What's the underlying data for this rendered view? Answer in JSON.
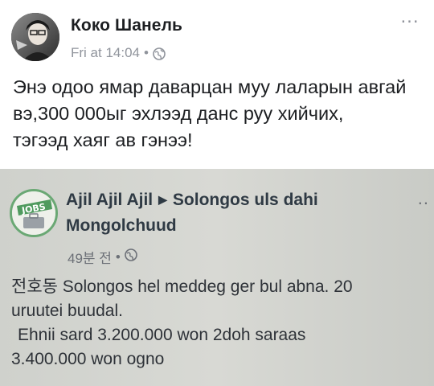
{
  "post": {
    "author": "Коко Шанель",
    "timestamp": "Fri at 14:04",
    "meta_separator": "•",
    "text_lines": [
      "Энэ одоо ямар даварцан муу лаларын авгай",
      "вэ,300 000ыг эхлээд данс руу хийчих,",
      "тэгээд хаяг  ав гэнээ!"
    ],
    "more_label": "...",
    "privacy_icon": "globe-icon"
  },
  "shared_post": {
    "page_name": "Ajil Ajil Ajil",
    "separator_icon": "triangle-right-icon",
    "group_name_part1": "Solongos uls dahi",
    "group_name_part2": "Mongolchuud",
    "time_ago": "49분 전",
    "meta_separator": "•",
    "more_label": "..",
    "avatar_text": "JOBS",
    "body_lines": [
      "전호동 Solongos hel meddeg ger bul  abna. 20",
      "uruutei buudal.",
      "Ehnii sard 3.200.000 won 2doh saraas",
      "3.400.000 won ogno"
    ]
  }
}
